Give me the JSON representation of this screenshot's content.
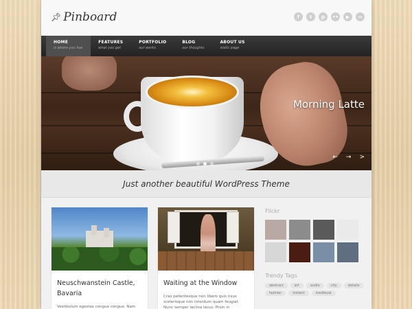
{
  "site": {
    "logo_text": "Pinboard",
    "social_icons": [
      "facebook-icon",
      "twitter-icon",
      "pinterest-icon",
      "flickr-icon",
      "youtube-icon",
      "rss-icon"
    ]
  },
  "nav": [
    {
      "title": "HOME",
      "subtitle": "is where you live",
      "active": true
    },
    {
      "title": "FEATURES",
      "subtitle": "what you get",
      "active": false
    },
    {
      "title": "PORTFOLIO",
      "subtitle": "our works",
      "active": false
    },
    {
      "title": "BLOG",
      "subtitle": "our thoughts",
      "active": false
    },
    {
      "title": "ABOUT US",
      "subtitle": "static page",
      "active": false
    }
  ],
  "slider": {
    "caption": "Morning Latte",
    "dot_count": 3,
    "active_dot": 1,
    "prev_arrow": "←",
    "next_arrow": "→",
    "more_arrow": ">"
  },
  "tagline": "Just another beautiful WordPress Theme",
  "posts": [
    {
      "title": "Neuschwanstein Castle, Bavaria",
      "excerpt": "Vestibulum egestas congue congue. Nam"
    },
    {
      "title": "Waiting at the Window",
      "excerpt": "Cras pellentesque non libero quis risus scelerisque non interdum quam feugiat. Nunc semper lacinia lacus. Proin in"
    }
  ],
  "sidebar": {
    "flickr_title": "Flickr",
    "flickr_colors": [
      "#b9a9a5",
      "#8c8c8c",
      "#5a5a5a",
      "#eaeaea",
      "#d7d7d7",
      "#4b1d12",
      "#7a8fa6",
      "#5f6f80"
    ],
    "tags_title": "Trendy Tags",
    "tags": [
      "abstract",
      "art",
      "audio",
      "city",
      "details",
      "fashion",
      "instant",
      "medieval"
    ]
  }
}
